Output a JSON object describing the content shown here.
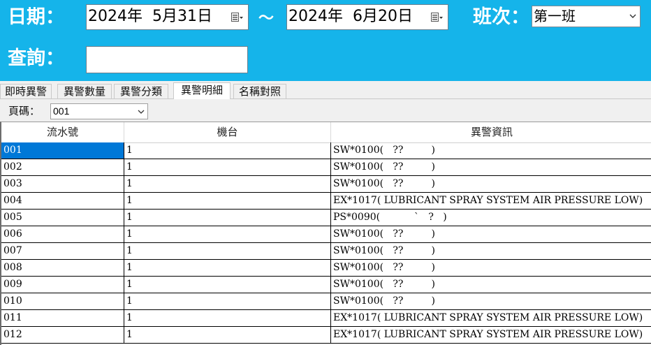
{
  "header": {
    "date_label": "日期：",
    "date_from": "2024年  5月31日",
    "tilde": "～",
    "date_to": "2024年  6月20日",
    "shift_label": "班次：",
    "shift_value": "第一班",
    "search_label": "查詢：",
    "search_value": ""
  },
  "tabs": [
    {
      "label": "即時異警"
    },
    {
      "label": "異警數量"
    },
    {
      "label": "異警分類"
    },
    {
      "label": "異警明細"
    },
    {
      "label": "名稱對照"
    }
  ],
  "active_tab": "異警明細",
  "pager": {
    "label": "頁碼：",
    "value": "001"
  },
  "table": {
    "columns": [
      "流水號",
      "機台",
      "異警資訊"
    ],
    "rows": [
      [
        "001",
        "1",
        "SW*0100(   ??         )"
      ],
      [
        "002",
        "1",
        "SW*0100(   ??         )"
      ],
      [
        "003",
        "1",
        "SW*0100(   ??         )"
      ],
      [
        "004",
        "1",
        "EX*1017( LUBRICANT SPRAY SYSTEM AIR PRESSURE LOW)"
      ],
      [
        "005",
        "1",
        "PS*0090(           `   ?   )"
      ],
      [
        "006",
        "1",
        "SW*0100(   ??         )"
      ],
      [
        "007",
        "1",
        "SW*0100(   ??         )"
      ],
      [
        "008",
        "1",
        "SW*0100(   ??         )"
      ],
      [
        "009",
        "1",
        "SW*0100(   ??         )"
      ],
      [
        "010",
        "1",
        "SW*0100(   ??         )"
      ],
      [
        "011",
        "1",
        "EX*1017( LUBRICANT SPRAY SYSTEM AIR PRESSURE LOW)"
      ],
      [
        "012",
        "1",
        "EX*1017( LUBRICANT SPRAY SYSTEM AIR PRESSURE LOW)"
      ]
    ]
  },
  "colors": {
    "header_bg": "#15b4ea",
    "selection": "#0078d7"
  }
}
